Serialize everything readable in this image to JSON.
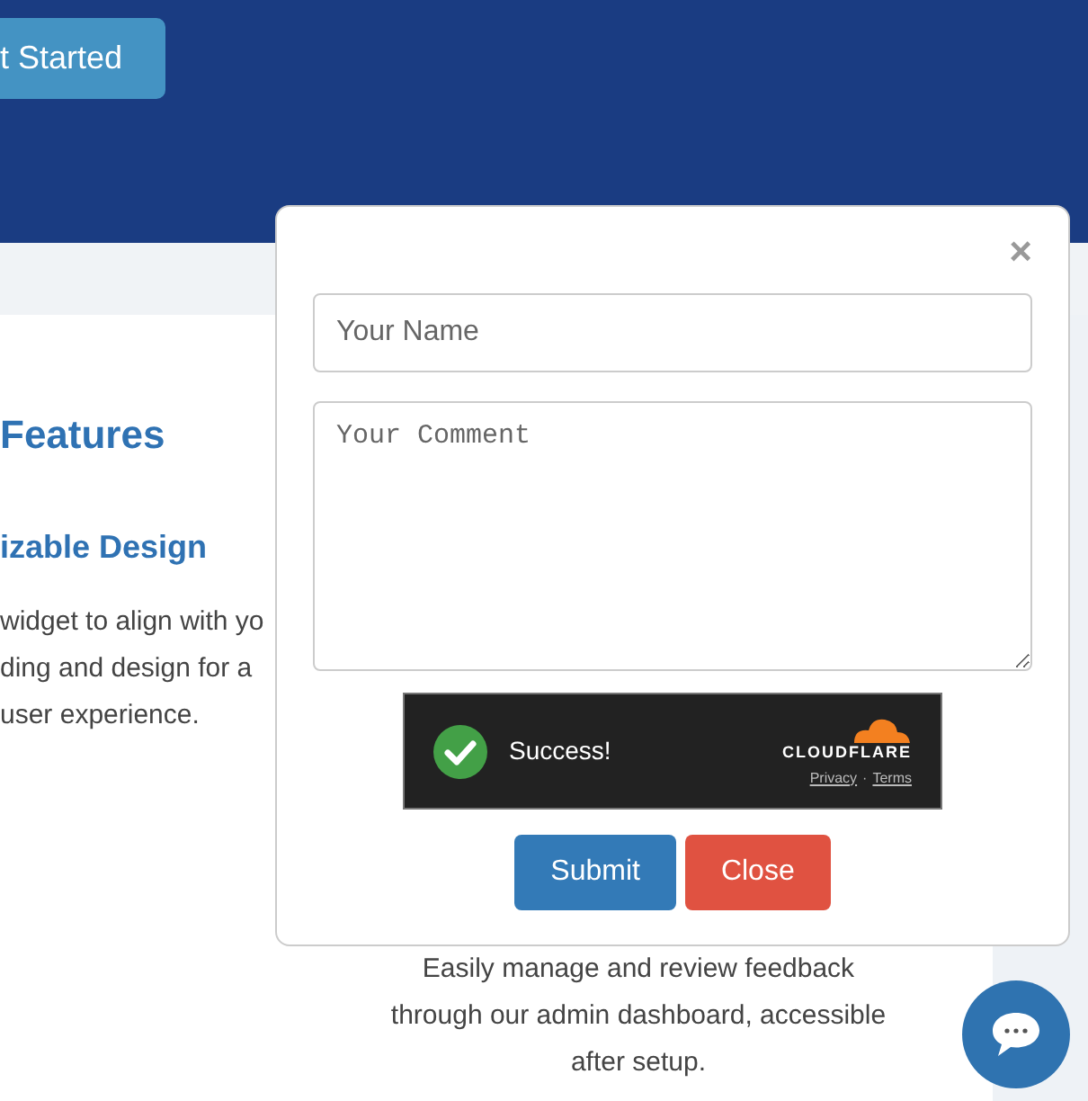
{
  "header": {
    "cta_button": "t Started"
  },
  "features": {
    "heading": "Features",
    "card_title": "izable Design",
    "card_text": [
      "widget to align with yo",
      "ding and design for a",
      "user experience."
    ],
    "second_card_text": [
      "Easily manage and review feedback",
      "through our admin dashboard, accessible",
      "after setup."
    ]
  },
  "modal": {
    "close": "×",
    "name_field": {
      "placeholder": "Your Name"
    },
    "comment_field": {
      "placeholder": "Your Comment"
    },
    "captcha": {
      "status": "Success!",
      "brand": "CLOUDFLARE",
      "links": [
        "Privacy",
        "Terms"
      ],
      "separator": "·"
    },
    "buttons": [
      {
        "label": "Submit",
        "kind": "primary"
      },
      {
        "label": "Close",
        "kind": "danger"
      }
    ]
  }
}
